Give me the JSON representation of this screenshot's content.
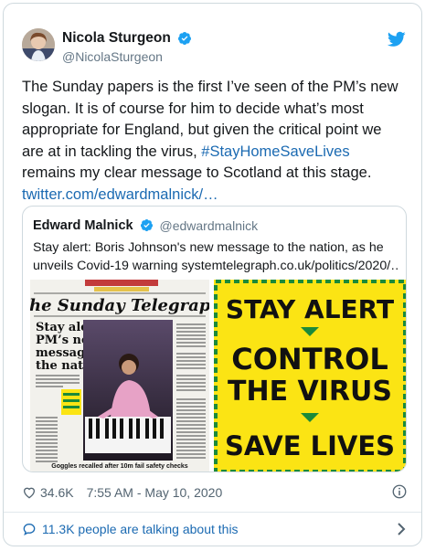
{
  "author": {
    "name": "Nicola Sturgeon",
    "handle": "@NicolaSturgeon",
    "verified_icon": "verified-badge-icon",
    "avatar_icon": "avatar-photo"
  },
  "tweet": {
    "text_before": "The Sunday papers is the first I’ve seen of the PM’s new slogan. It is of course for him to decide what’s most appropriate for England, but given the critical point we are at in tackling the virus, ",
    "hashtag": "#StayHomeSaveLives",
    "text_after": " remains my clear message to Scotland at this stage.",
    "link": "twitter.com/edwardmalnick/…"
  },
  "quoted": {
    "name": "Edward Malnick",
    "handle": "@edwardmalnick",
    "text_line1": "Stay alert: Boris Johnson's new message to the nation, as he",
    "text_line2": "unveils Covid-19 warning systemtelegraph.co.uk/politics/2020/…",
    "newspaper": {
      "masthead": "The Sunday Telegraph",
      "headline_lines": [
        "Stay alert:",
        "PM’s new",
        "message to",
        "the nation"
      ],
      "bottom_headline": "Goggles recalled after 10m fail safety checks"
    },
    "poster": {
      "line1": "STAY ALERT",
      "line2": "CONTROL",
      "line3": "THE VIRUS",
      "line4": "SAVE LIVES"
    }
  },
  "footer": {
    "likes": "34.6K",
    "timestamp": "7:55 AM - May 10, 2020",
    "talking": "11.3K people are talking about this"
  },
  "colors": {
    "link": "#1b6ab2",
    "twitter_blue": "#1da1f2",
    "poster_yellow": "#fbe414",
    "poster_green": "#1b8a3a"
  }
}
